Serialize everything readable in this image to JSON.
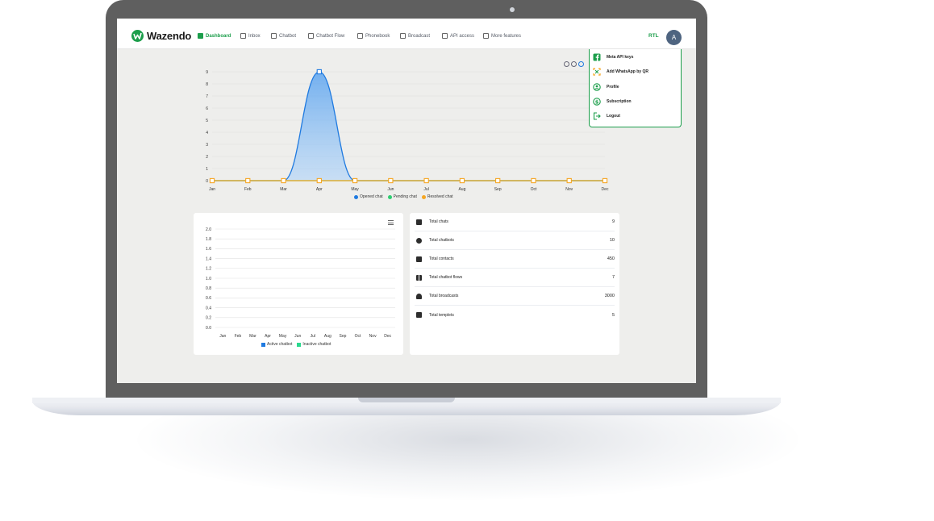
{
  "app": {
    "brand": "Wazendo"
  },
  "nav": {
    "items": [
      {
        "label": "Dashboard",
        "active": true
      },
      {
        "label": "Inbox"
      },
      {
        "label": "Chatbot"
      },
      {
        "label": "Chatbot Flow"
      },
      {
        "label": "Phonebook"
      },
      {
        "label": "Broadcast"
      },
      {
        "label": "API access"
      },
      {
        "label": "More features"
      }
    ],
    "rtl": "RTL",
    "avatar": "A"
  },
  "dropdown": {
    "items": [
      {
        "label": "Meta API keys",
        "icon": "facebook-icon"
      },
      {
        "label": "Add WhatsApp by QR",
        "icon": "qr-scan-icon"
      },
      {
        "label": "Profile",
        "icon": "user-circle-icon"
      },
      {
        "label": "Subscription",
        "icon": "dollar-icon"
      },
      {
        "label": "Logout",
        "icon": "logout-icon"
      }
    ]
  },
  "colors": {
    "brand": "#1c9e4b",
    "opened": "#1f7ae0",
    "pending": "#2ecc71",
    "resolved": "#f5a623",
    "active_bar": "#1f7ae0",
    "inactive_bar": "#2bd98f"
  },
  "chart_data": [
    {
      "type": "area",
      "categories": [
        "Jan",
        "Feb",
        "Mar",
        "Apr",
        "May",
        "Jun",
        "Jul",
        "Aug",
        "Sep",
        "Oct",
        "Nov",
        "Dec"
      ],
      "y_ticks": [
        "0",
        "1",
        "2",
        "3",
        "4",
        "5",
        "6",
        "7",
        "8",
        "9"
      ],
      "ylim": [
        0,
        9
      ],
      "series": [
        {
          "name": "Opened chat",
          "values": [
            0,
            0,
            0,
            9,
            0,
            0,
            0,
            0,
            0,
            0,
            0,
            0
          ]
        },
        {
          "name": "Pending chat",
          "values": [
            0,
            0,
            0,
            0,
            0,
            0,
            0,
            0,
            0,
            0,
            0,
            0
          ]
        },
        {
          "name": "Resolved chat",
          "values": [
            0,
            0,
            0,
            0,
            0,
            0,
            0,
            0,
            0,
            0,
            0,
            0
          ]
        }
      ],
      "grid": true,
      "legend": "bottom"
    },
    {
      "type": "bar",
      "categories": [
        "Jan",
        "Feb",
        "Mar",
        "Apr",
        "May",
        "Jun",
        "Jul",
        "Aug",
        "Sep",
        "Oct",
        "Nov",
        "Dec"
      ],
      "y_ticks": [
        "0.0",
        "0.2",
        "0.4",
        "0.6",
        "0.8",
        "1.0",
        "1.2",
        "1.4",
        "1.6",
        "1.8",
        "2.0"
      ],
      "ylim": [
        0,
        2
      ],
      "series": [
        {
          "name": "Active chatbot",
          "values": [
            0,
            0,
            0,
            0,
            0,
            0,
            0,
            0,
            0,
            0,
            0,
            0
          ]
        },
        {
          "name": "Inactive chatbot",
          "values": [
            0,
            0,
            0,
            0,
            0,
            0,
            0,
            0,
            0,
            0,
            0,
            0
          ]
        }
      ],
      "grid": true,
      "legend": "bottom"
    }
  ],
  "stats": [
    {
      "label": "Total chats",
      "value": "9",
      "icon": "chat-icon"
    },
    {
      "label": "Total chatbots",
      "value": "10",
      "icon": "robot-icon"
    },
    {
      "label": "Total contacts",
      "value": "450",
      "icon": "contact-card-icon"
    },
    {
      "label": "Total chatbot flows",
      "value": "7",
      "icon": "flow-icon"
    },
    {
      "label": "Total broadcasts",
      "value": "3000",
      "icon": "broadcast-icon"
    },
    {
      "label": "Total templets",
      "value": "5",
      "icon": "facebook-icon"
    }
  ]
}
